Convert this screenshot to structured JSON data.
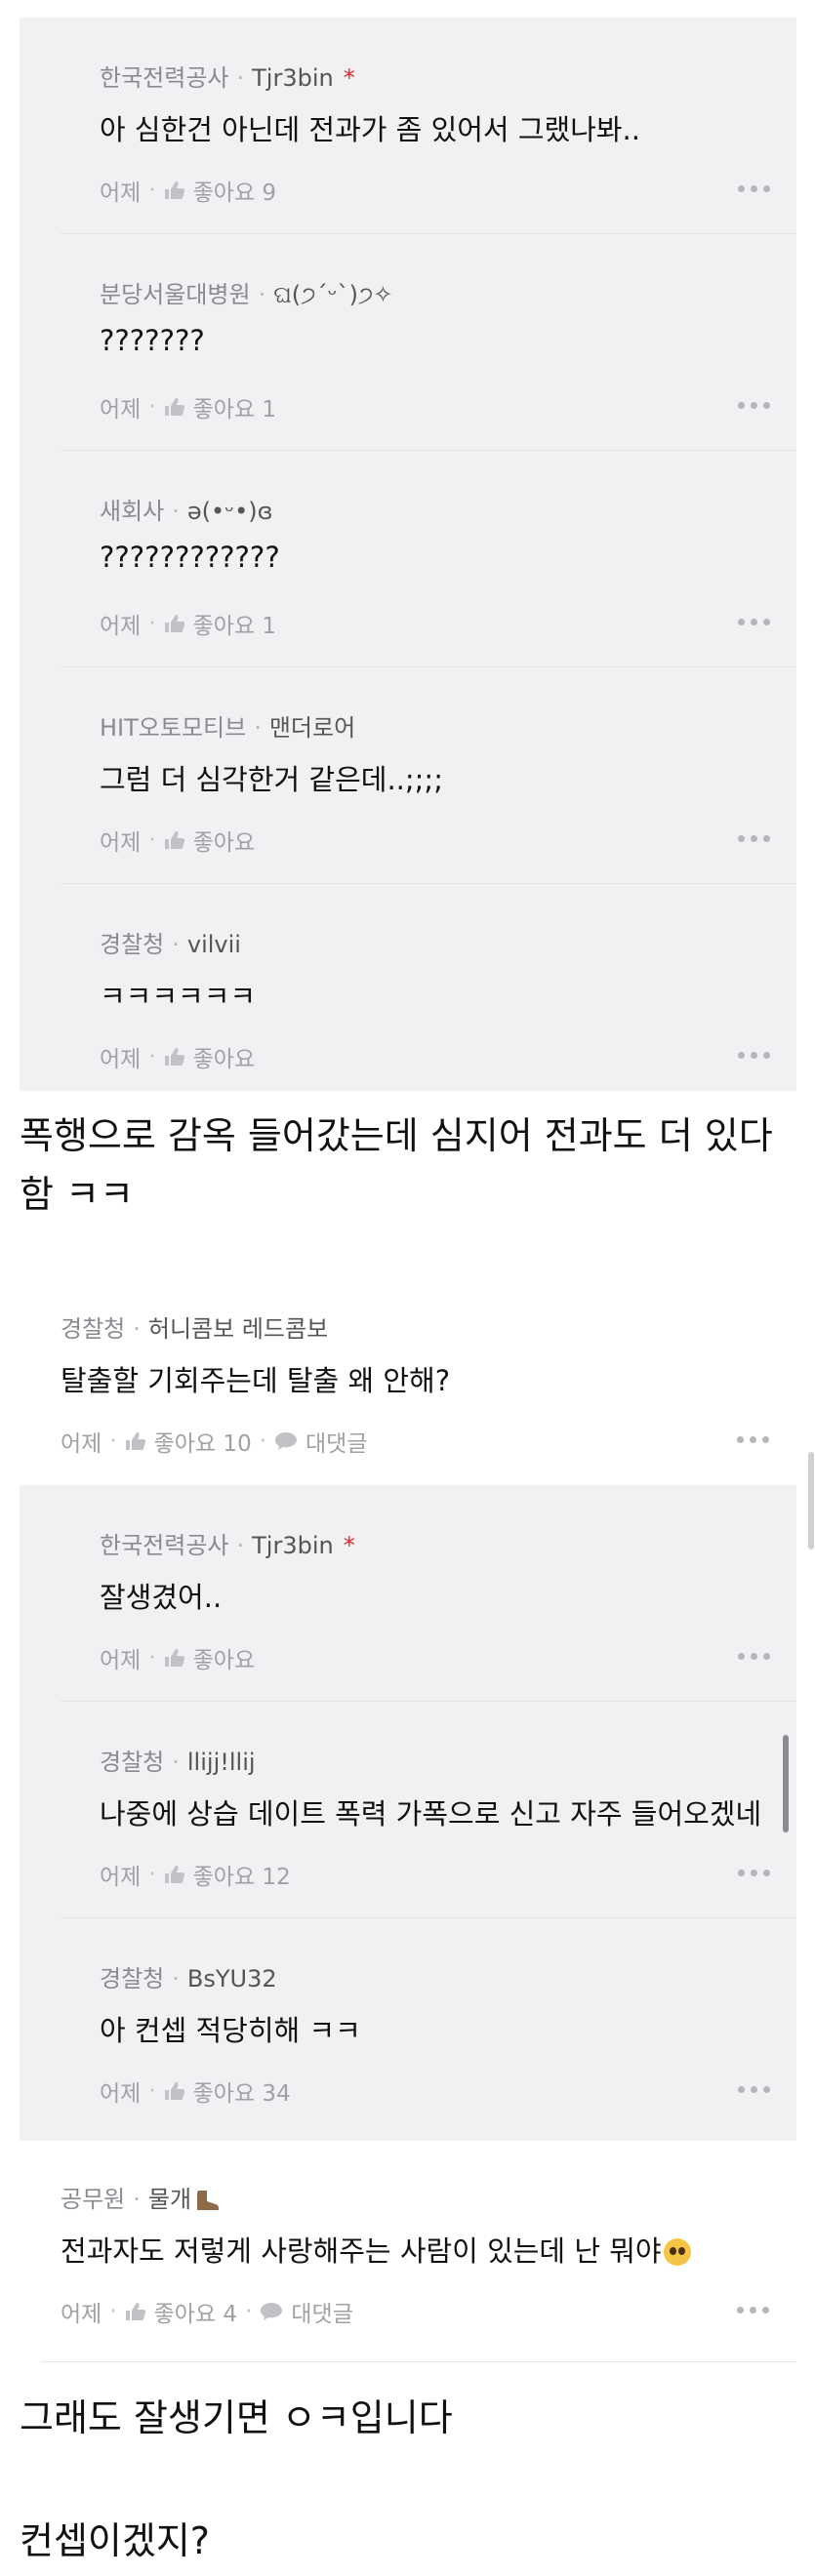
{
  "block1": [
    {
      "company": "한국전력공사",
      "nick": "Tjr3bin",
      "star": "*",
      "text": "아 심한건 아닌데 전과가 좀 있어서 그랬나봐..",
      "time": "어제",
      "like": "좋아요 9"
    },
    {
      "company": "분당서울대병원",
      "nick": "ଘ(੭ˊᵕˋ)੭✧",
      "star": "",
      "text": "???????",
      "time": "어제",
      "like": "좋아요 1"
    },
    {
      "company": "새회사",
      "nick": "ə(•ᵕ•)ɞ",
      "star": "",
      "text": "????????????",
      "time": "어제",
      "like": "좋아요 1"
    },
    {
      "company": "HIT오토모티브",
      "nick": "맨더로어",
      "star": "",
      "text": "그럼 더 심각한거 같은데..;;;;",
      "time": "어제",
      "like": "좋아요"
    },
    {
      "company": "경찰청",
      "nick": "vilvii",
      "star": "",
      "text": "ㅋㅋㅋㅋㅋㅋ",
      "time": "어제",
      "like": "좋아요"
    }
  ],
  "post1": {
    "line1": "폭행으로 감옥 들어갔는데 심지어 전과도 더 있다",
    "line2": "함 ㅋㅋ"
  },
  "comment1": {
    "company": "경찰청",
    "nick": "허니콤보 레드콤보",
    "text": "탈출할 기회주는데 탈출 왜 안해?",
    "time": "어제",
    "like": "좋아요 10",
    "reply": "대댓글"
  },
  "block2": [
    {
      "company": "한국전력공사",
      "nick": "Tjr3bin",
      "star": "*",
      "text": "잘생겼어..",
      "time": "어제",
      "like": "좋아요"
    },
    {
      "company": "경찰청",
      "nick": "llijj!llij",
      "star": "",
      "text": "나중에 상습 데이트 폭력 가폭으로 신고 자주 들어오겠네",
      "time": "어제",
      "like": "좋아요 12"
    },
    {
      "company": "경찰청",
      "nick": "BsYU32",
      "star": "",
      "text": "아 컨셉 적당히해 ㅋㅋ",
      "time": "어제",
      "like": "좋아요 34"
    }
  ],
  "comment2": {
    "company": "공무원",
    "nick": "물개",
    "text": "전과자도 저렇게 사랑해주는 사람이 있는데 난 뭐야",
    "time": "어제",
    "like": "좋아요 4",
    "reply": "대댓글"
  },
  "post2": {
    "line1": "그래도 잘생기면 ㅇㅋ입니다"
  },
  "post3": {
    "line1": "컨셉이겠지?"
  },
  "dot_sep": "·",
  "icons": {
    "like": "thumbs-up-icon",
    "reply": "speech-bubble-icon",
    "more": "more-dots-icon",
    "emoji": "pleading-face-emoji",
    "boot": "boot-icon"
  }
}
